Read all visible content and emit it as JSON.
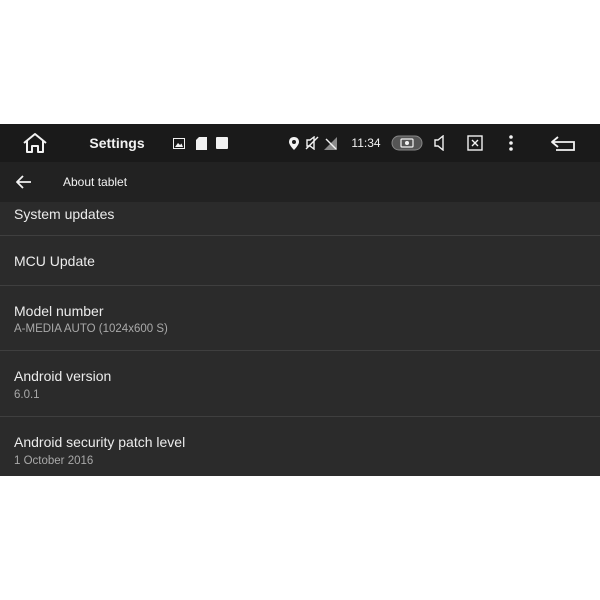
{
  "status_bar": {
    "title": "Settings",
    "time": "11:34",
    "icons": [
      "home-icon",
      "image-icon",
      "sd-card-icon",
      "stop-square-icon",
      "location-pin-icon",
      "mute-icon",
      "no-signal-icon",
      "camera-icon",
      "volume-icon",
      "screenshot-icon",
      "more-vert-icon",
      "back-arrow-icon"
    ]
  },
  "app_bar": {
    "title": "About tablet",
    "back_icon": "arrow-left-icon"
  },
  "items": [
    {
      "title": "System updates",
      "summary": ""
    },
    {
      "title": "MCU Update",
      "summary": ""
    },
    {
      "title": "Model number",
      "summary": "A-MEDIA AUTO (1024x600 S)"
    },
    {
      "title": "Android version",
      "summary": "6.0.1"
    },
    {
      "title": "Android security patch level",
      "summary": "1 October 2016"
    }
  ],
  "colors": {
    "status_bar_bg": "#1a1a1a",
    "app_bar_bg": "#222222",
    "list_bg": "#2b2b2b",
    "text_primary": "#ececec",
    "text_secondary": "#a9a9a9",
    "divider": "#3f3f3f"
  }
}
